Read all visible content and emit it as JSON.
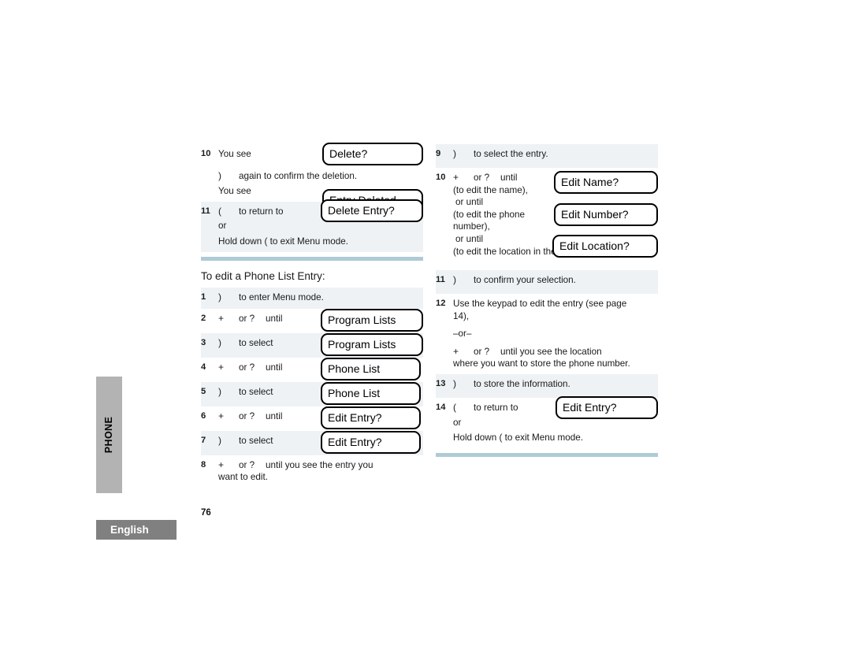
{
  "page": {
    "number": "76",
    "side_tab": "PHONE",
    "language_tab": "English"
  },
  "left_column": {
    "steps": [
      {
        "num": "10",
        "lines": [
          {
            "key": "",
            "text": "You see"
          }
        ],
        "extra_lines": [
          {
            "key": ")",
            "text": "again to confirm the deletion."
          },
          {
            "key": "",
            "text": "You see"
          }
        ],
        "displays": [
          "Delete?",
          "Entry Deleted"
        ]
      },
      {
        "num": "11",
        "lines": [
          {
            "key": "(",
            "text": "to return to"
          }
        ],
        "extra_lines": [
          {
            "key": "",
            "text": "or"
          },
          {
            "key": "",
            "text": "Hold down (      to exit Menu mode."
          }
        ],
        "displays": [
          "Delete Entry?"
        ]
      }
    ],
    "section_title": "To edit a Phone List Entry:",
    "edit_steps": [
      {
        "num": "1",
        "key": ")",
        "text": "to enter Menu mode.",
        "display": ""
      },
      {
        "num": "2",
        "key": "+",
        "or": "or  ?",
        "until": "until",
        "display": "Program Lists"
      },
      {
        "num": "3",
        "key": ")",
        "text": "to select",
        "display": "Program Lists"
      },
      {
        "num": "4",
        "key": "+",
        "or": "or  ?",
        "until": "until",
        "display": "Phone List"
      },
      {
        "num": "5",
        "key": ")",
        "text": "to select",
        "display": "Phone List"
      },
      {
        "num": "6",
        "key": "+",
        "or": "or  ?",
        "until": "until",
        "display": "Edit Entry?"
      },
      {
        "num": "7",
        "key": ")",
        "text": "to select",
        "display": "Edit Entry?"
      },
      {
        "num": "8",
        "key": "+",
        "or": "or  ?",
        "until": "until you see the entry you",
        "second_line": "want to edit.",
        "display": ""
      }
    ]
  },
  "right_column": {
    "step9": {
      "num": "9",
      "key": ")",
      "text": "to select the entry."
    },
    "step10": {
      "num": "10",
      "key": "+",
      "or": "or ?",
      "until": "until",
      "line2": "(to edit the name),",
      "line3": "or until",
      "line4": "(to edit the phone",
      "line5": "number),",
      "line6": "or until",
      "line7": "(to edit the location in the phone list).",
      "displays": [
        "Edit Name?",
        "Edit Number?",
        "Edit Location?"
      ]
    },
    "step11": {
      "num": "11",
      "key": ")",
      "text": "to confirm your selection."
    },
    "step12": {
      "num": "12",
      "line1": "Use the keypad to edit the entry (see page",
      "line2": "14),",
      "dash": "–or–",
      "key": "+",
      "or": "or  ?",
      "line3": "until you see the location",
      "line4": "where you want to store the phone number."
    },
    "step13": {
      "num": "13",
      "key": ")",
      "text": "to store the information."
    },
    "step14": {
      "num": "14",
      "key": "(",
      "text": "to return to",
      "line2": "or",
      "line3": "Hold down (       to exit Menu mode.",
      "display": "Edit Entry?"
    }
  },
  "colors": {
    "row_shade": "#eef2f5",
    "rule": "#aecbd6",
    "phone_tab": "#b3b3b3",
    "language_tab": "#808080"
  }
}
